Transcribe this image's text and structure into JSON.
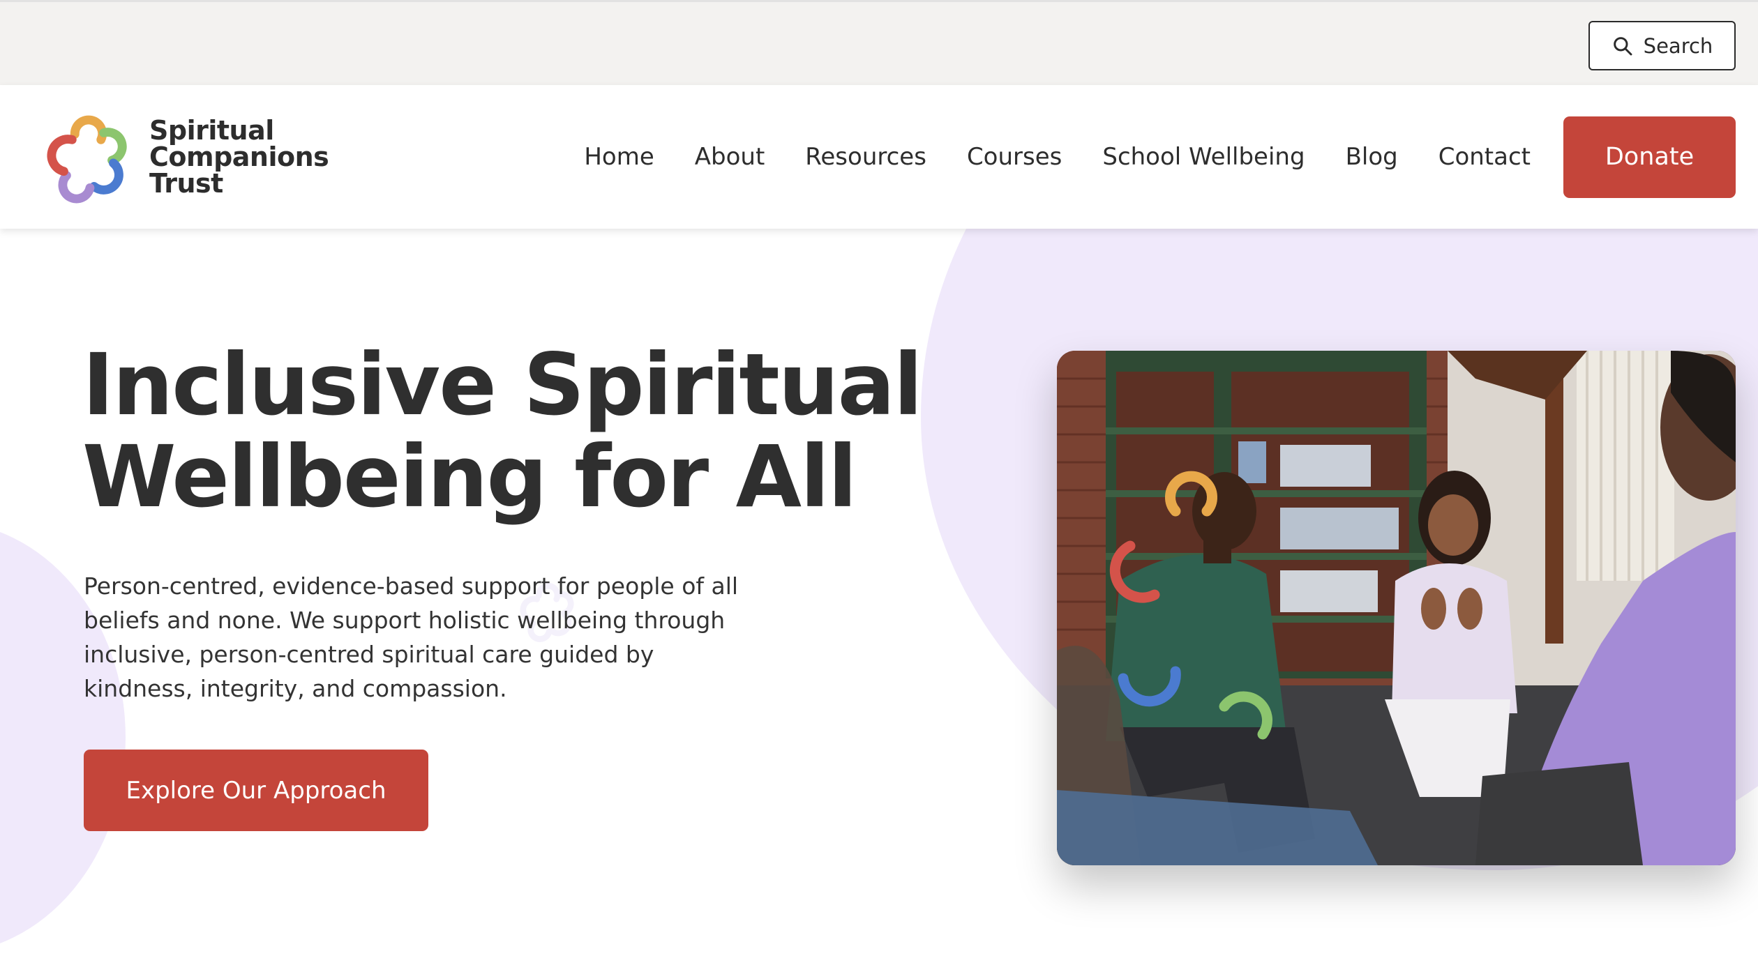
{
  "utility": {
    "search_label": "Search"
  },
  "brand": {
    "line1": "Spiritual",
    "line2": "Companions",
    "line3": "Trust"
  },
  "nav": {
    "items": [
      {
        "label": "Home"
      },
      {
        "label": "About"
      },
      {
        "label": "Resources"
      },
      {
        "label": "Courses"
      },
      {
        "label": "School Wellbeing"
      },
      {
        "label": "Blog"
      },
      {
        "label": "Contact"
      }
    ],
    "donate_label": "Donate"
  },
  "hero": {
    "title_line1": "Inclusive Spiritual",
    "title_line2": "Wellbeing for All",
    "body": "Person-centred, evidence-based support for people of all beliefs and none. We support holistic wellbeing through inclusive, person-centred spiritual care guided by kindness, integrity, and compassion.",
    "cta_label": "Explore Our Approach"
  },
  "colors": {
    "accent": "#c4453a",
    "utility_bar": "#f3f2f0",
    "blob": "#f0e9fb",
    "text": "#2f2f2f",
    "logo_orange": "#e8a84a",
    "logo_green": "#8cc56e",
    "logo_blue": "#4b7bd0",
    "logo_purple": "#a88bd1",
    "logo_red": "#d4534a"
  },
  "icons": {
    "search": "search-icon",
    "logo": "knot-logo-icon"
  }
}
